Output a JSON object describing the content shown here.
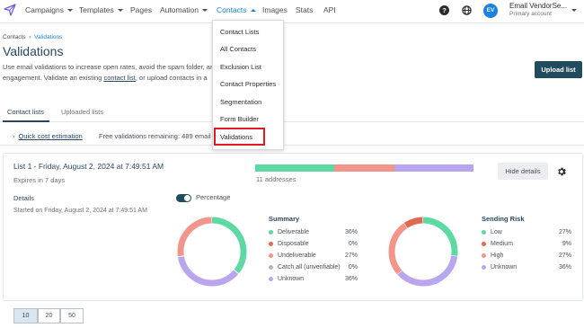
{
  "nav": {
    "items": [
      {
        "label": "Campaigns",
        "has_caret": true
      },
      {
        "label": "Templates",
        "has_caret": true
      },
      {
        "label": "Pages",
        "has_caret": false
      },
      {
        "label": "Automation",
        "has_caret": true
      },
      {
        "label": "Contacts",
        "has_caret": true,
        "active": true
      },
      {
        "label": "Images",
        "has_caret": false
      },
      {
        "label": "Stats",
        "has_caret": false
      },
      {
        "label": "API",
        "has_caret": false
      }
    ],
    "logo_icon": "paper-plane-icon",
    "help_icon": "help-circle-icon",
    "globe_icon": "globe-icon"
  },
  "account": {
    "initials": "EV",
    "name": "Email VendorSe...",
    "role": "Primary account"
  },
  "breadcrumb": {
    "root": "Contacts",
    "current": "Validations"
  },
  "page": {
    "title": "Validations",
    "desc_part1": "Use email validations to increase open rates, avoid the spam folder, an",
    "desc_part2": "engagement. Validate an existing",
    "desc_link": "contact list",
    "desc_part3": ", or upload contacts in a",
    "upload_label": "Upload list"
  },
  "tabs": [
    "Contact lists",
    "Uploaded lists"
  ],
  "quick": {
    "label": "Quick cost estimation",
    "free_text": "Free validations remaining: 489 email"
  },
  "card": {
    "title": "List 1 - Friday, August 2, 2024 at 7:49:51 AM",
    "expires": "Expires in 7 days",
    "addresses": "11 addresses",
    "hide_label": "Hide details",
    "details_label": "Details",
    "started": "Started on Friday, August 2, 2024 at 7:49:51 AM",
    "percentage_label": "Percentage",
    "percentage_on": true
  },
  "colors": {
    "green": "#5fd9a3",
    "red": "#f4958c",
    "purple": "#b9a6ef",
    "gray": "#b1b7bf",
    "orange": "#e0694f",
    "accent": "#1a82e2",
    "navy": "#294661"
  },
  "summary": {
    "title": "Summary",
    "rows": [
      {
        "label": "Deliverable",
        "value": "36%",
        "color": "#5fd9a3"
      },
      {
        "label": "Disposable",
        "value": "0%",
        "color": "#e0694f"
      },
      {
        "label": "Undeliverable",
        "value": "27%",
        "color": "#f4958c"
      },
      {
        "label": "Catch all (unverifiable)",
        "value": "0%",
        "color": "#b1b7bf"
      },
      {
        "label": "Unknown",
        "value": "36%",
        "color": "#b9a6ef"
      }
    ]
  },
  "risk": {
    "title": "Sending Risk",
    "rows": [
      {
        "label": "Low",
        "value": "27%",
        "color": "#5fd9a3"
      },
      {
        "label": "Medium",
        "value": "9%",
        "color": "#e0694f"
      },
      {
        "label": "High",
        "value": "27%",
        "color": "#f4958c"
      },
      {
        "label": "Unknown",
        "value": "36%",
        "color": "#b9a6ef"
      }
    ]
  },
  "pager": [
    "10",
    "20",
    "50"
  ],
  "dropdown": {
    "items": [
      "Contact Lists",
      "All Contacts",
      "Exclusion List",
      "Contact Properties",
      "Segmentation",
      "Form Builder",
      "Validations"
    ],
    "highlighted": "Validations"
  }
}
